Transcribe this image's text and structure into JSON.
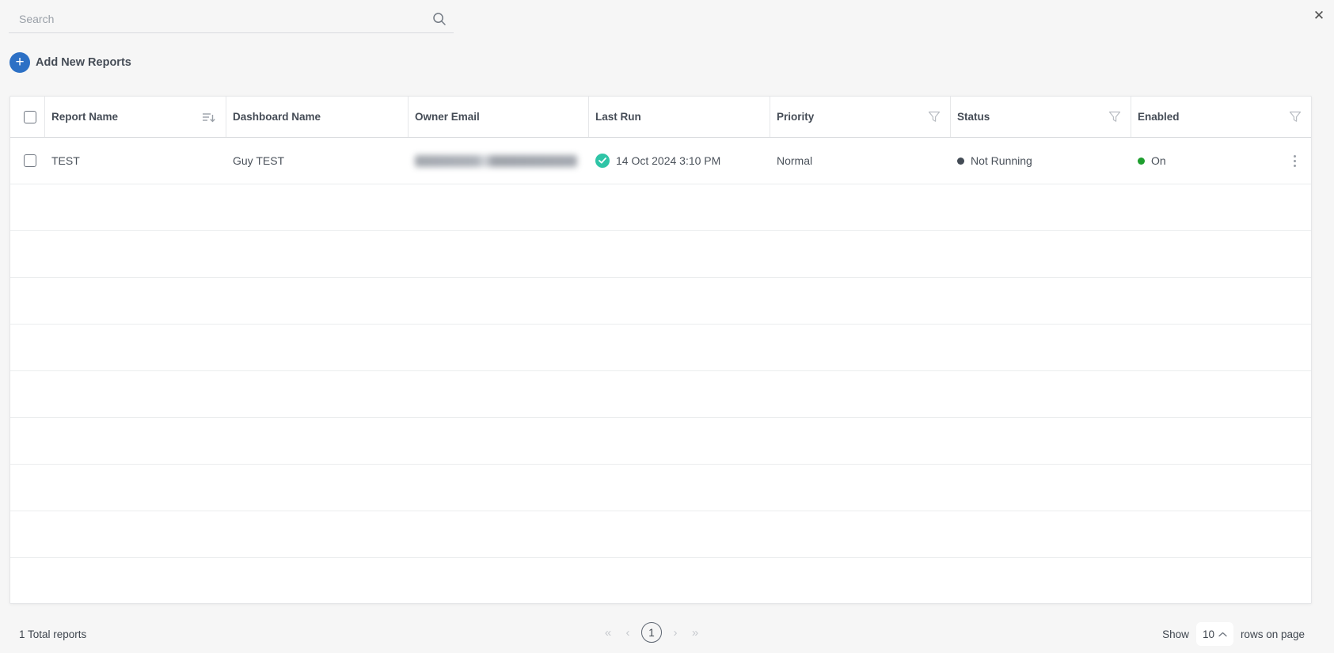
{
  "window": {
    "close_icon": "✕"
  },
  "search": {
    "placeholder": "Search",
    "value": "",
    "icon": "search-icon"
  },
  "actions": {
    "add_new_reports_label": "Add New Reports",
    "plus_icon": "+"
  },
  "table": {
    "columns": [
      {
        "label": "Report Name",
        "icon": "sort-icon"
      },
      {
        "label": "Dashboard Name"
      },
      {
        "label": "Owner Email"
      },
      {
        "label": "Last Run"
      },
      {
        "label": "Priority",
        "icon": "filter-icon"
      },
      {
        "label": "Status",
        "icon": "filter-icon"
      },
      {
        "label": "Enabled",
        "icon": "filter-icon"
      }
    ],
    "rows": [
      {
        "report_name": "TEST",
        "dashboard_name": "Guy TEST",
        "owner_email_redacted": true,
        "last_run": "14 Oct 2024 3:10 PM",
        "last_run_icon": "check-circle-icon",
        "priority": "Normal",
        "status": "Not Running",
        "enabled": "On"
      }
    ],
    "empty_row_count": 9
  },
  "footer": {
    "total_label": "1 Total reports",
    "pagination": {
      "first": "«",
      "prev": "‹",
      "page": "1",
      "next": "›",
      "last": "»"
    },
    "rows_per_page": {
      "show_label": "Show",
      "value": "10",
      "suffix_label": "rows on page"
    }
  },
  "colors": {
    "accent_blue": "#2c70c5",
    "check_teal": "#2ec4a6",
    "enabled_green": "#1e9e2e",
    "status_dot_gray": "#434b55",
    "text_dark": "#454c56",
    "muted_gray": "#9aa0a8",
    "page_bg": "#f6f6f6",
    "border_light": "#ebedee"
  }
}
